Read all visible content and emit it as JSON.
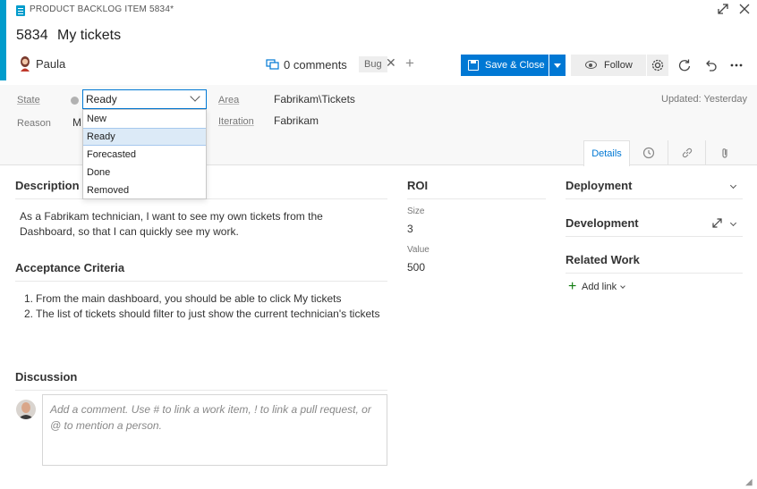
{
  "header": {
    "type_label": "PRODUCT BACKLOG ITEM 5834*",
    "id": "5834",
    "title": "My tickets",
    "assignee": "Paula",
    "comments": "0 comments",
    "tag": "Bug",
    "save_label": "Save & Close",
    "follow_label": "Follow"
  },
  "fields": {
    "state_label": "State",
    "state_value": "Ready",
    "reason_label": "Reason",
    "reason_value_partial": "M",
    "area_label": "Area",
    "area_value": "Fabrikam\\Tickets",
    "iteration_label": "Iteration",
    "iteration_value": "Fabrikam",
    "updated": "Updated: Yesterday"
  },
  "state_options": [
    "New",
    "Ready",
    "Forecasted",
    "Done",
    "Removed"
  ],
  "state_selected": "Ready",
  "tabs": {
    "details": "Details"
  },
  "description": {
    "title": "Description",
    "text": "As a Fabrikam technician, I want to see my own tickets from the Dashboard, so that I can quickly see my work."
  },
  "acceptance": {
    "title": "Acceptance Criteria",
    "items": [
      "From the main dashboard, you should be able to click My tickets",
      "The list of tickets should filter to just show the current technician's tickets"
    ]
  },
  "discussion": {
    "title": "Discussion",
    "placeholder": "Add a comment. Use # to link a work item, ! to link a pull request, or @ to mention a person."
  },
  "roi": {
    "title": "ROI",
    "size_label": "Size",
    "size_value": "3",
    "value_label": "Value",
    "value_value": "500"
  },
  "right": {
    "deployment": "Deployment",
    "development": "Development",
    "related_work": "Related Work",
    "add_link": "Add link"
  },
  "colors": {
    "accent": "#009ccc",
    "primary": "#0078d4",
    "selected_option": "#dceaf7"
  }
}
